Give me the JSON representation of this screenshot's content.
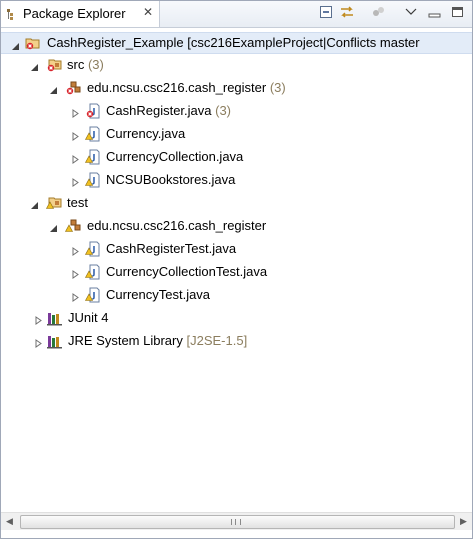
{
  "view": {
    "tab_label": "Package Explorer",
    "close_glyph": "✕"
  },
  "toolbar": {
    "icons": [
      "collapse-all-icon",
      "link-with-editor-icon",
      "filters-icon",
      "view-menu-icon",
      "minimize-icon",
      "maximize-icon"
    ]
  },
  "tree": {
    "project": {
      "label": "CashRegister_Example",
      "suffix": "[csc216ExampleProject|Conflicts master"
    },
    "src": {
      "label": "src",
      "suffix": "(3)"
    },
    "src_pkg": {
      "label": "edu.ncsu.csc216.cash_register",
      "suffix": "(3)"
    },
    "src_files": [
      {
        "label": "CashRegister.java",
        "suffix": "(3)"
      },
      {
        "label": "Currency.java",
        "suffix": ""
      },
      {
        "label": "CurrencyCollection.java",
        "suffix": ""
      },
      {
        "label": "NCSUBookstores.java",
        "suffix": ""
      }
    ],
    "test": {
      "label": "test"
    },
    "test_pkg": {
      "label": "edu.ncsu.csc216.cash_register"
    },
    "test_files": [
      {
        "label": "CashRegisterTest.java"
      },
      {
        "label": "CurrencyCollectionTest.java"
      },
      {
        "label": "CurrencyTest.java"
      }
    ],
    "junit": {
      "label": "JUnit 4"
    },
    "jre": {
      "label": "JRE System Library",
      "suffix": "[J2SE-1.5]"
    }
  },
  "colors": {
    "selection": "#e3ecf8",
    "decoration": "#8b7d5e",
    "error": "#d8242c"
  }
}
